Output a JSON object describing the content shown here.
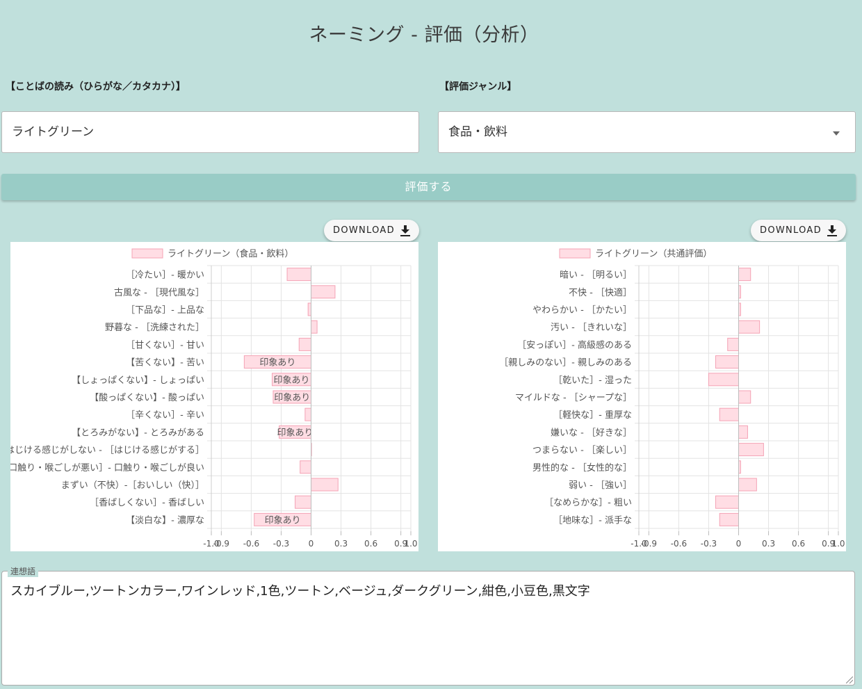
{
  "header": {
    "title": "ネーミング - 評価（分析）"
  },
  "form": {
    "reading_label": "【ことばの読み（ひらがな／カタカナ）】",
    "reading_value": "ライトグリーン",
    "genre_label": "【評価ジャンル】",
    "genre_value": "食品・飲料",
    "submit_label": "評価する"
  },
  "download_label": "DOWNLOAD",
  "charts": [
    {
      "legend": "ライトグリーン（食品・飲料）",
      "ticks": [
        "-1.0",
        "-0.9",
        "-0.6",
        "-0.3",
        "0",
        "0.3",
        "0.6",
        "0.9",
        "1.0"
      ],
      "tick_values": [
        -1.0,
        -0.9,
        -0.6,
        -0.3,
        0,
        0.3,
        0.6,
        0.9,
        1.0
      ],
      "categories": [
        "［冷たい］- 暖かい",
        "古風な - ［現代風な］",
        "［下品な］- 上品な",
        "野暮な - ［洗練された］",
        "［甘くない］- 甘い",
        "【苦くない】- 苦い",
        "【しょっぱくない】- しょっぱい",
        "【酸っぱくない】- 酸っぱい",
        "［辛くない］- 辛い",
        "【とろみがない】- とろみがある",
        "はじける感じがしない - ［はじける感じがする］",
        "口触り・喉ごしが悪い］- 口触り・喉ごしが良い",
        "まずい（不快）-［おいしい（快）］",
        "［香ばしくない］- 香ばしい",
        "【淡白な】- 濃厚な"
      ],
      "values": [
        -0.24,
        0.24,
        -0.03,
        0.06,
        -0.12,
        -0.67,
        -0.39,
        -0.38,
        -0.06,
        -0.32,
        0.0,
        -0.11,
        0.27,
        -0.16,
        -0.57
      ],
      "bar_labels": [
        "",
        "",
        "",
        "",
        "",
        "印象あり",
        "印象あり",
        "印象あり",
        "",
        "印象あり",
        "",
        "",
        "",
        "",
        "印象あり"
      ]
    },
    {
      "legend": "ライトグリーン（共通評価）",
      "ticks": [
        "-1.0",
        "-0.9",
        "-0.6",
        "-0.3",
        "0",
        "0.3",
        "0.6",
        "0.9",
        "1.0"
      ],
      "tick_values": [
        -1.0,
        -0.9,
        -0.6,
        -0.3,
        0,
        0.3,
        0.6,
        0.9,
        1.0
      ],
      "categories": [
        "暗い - ［明るい］",
        "不快 - ［快適］",
        "やわらかい - ［かたい］",
        "汚い - ［きれいな］",
        "［安っぽい］- 高級感のある",
        "［親しみのない］- 親しみのある",
        "［乾いた］- 湿った",
        "マイルドな - ［シャープな］",
        "［軽快な］- 重厚な",
        "嫌いな - ［好きな］",
        "つまらない - ［楽しい］",
        "男性的な - ［女性的な］",
        "弱い - ［強い］",
        "［なめらかな］- 粗い",
        "［地味な］- 派手な"
      ],
      "values": [
        0.12,
        0.02,
        0.02,
        0.21,
        -0.11,
        -0.23,
        -0.3,
        0.12,
        -0.19,
        0.09,
        0.25,
        0.02,
        0.18,
        -0.23,
        -0.19
      ],
      "bar_labels": [
        "",
        "",
        "",
        "",
        "",
        "",
        "",
        "",
        "",
        "",
        "",
        "",
        "",
        "",
        ""
      ]
    }
  ],
  "associations": {
    "legend": "連想語",
    "text": "スカイブルー,ツートンカラー,ワインレッド,1色,ツートン,ベージュ,ダークグリーン,紺色,小豆色,黒文字"
  },
  "colors": {
    "background": "#c0e0dc",
    "button": "#99ccc6",
    "bar_fill": "#ffdde4",
    "bar_stroke": "#f4a3b5"
  },
  "icons": {
    "download": "download-icon",
    "select": "chevron-down-icon"
  }
}
